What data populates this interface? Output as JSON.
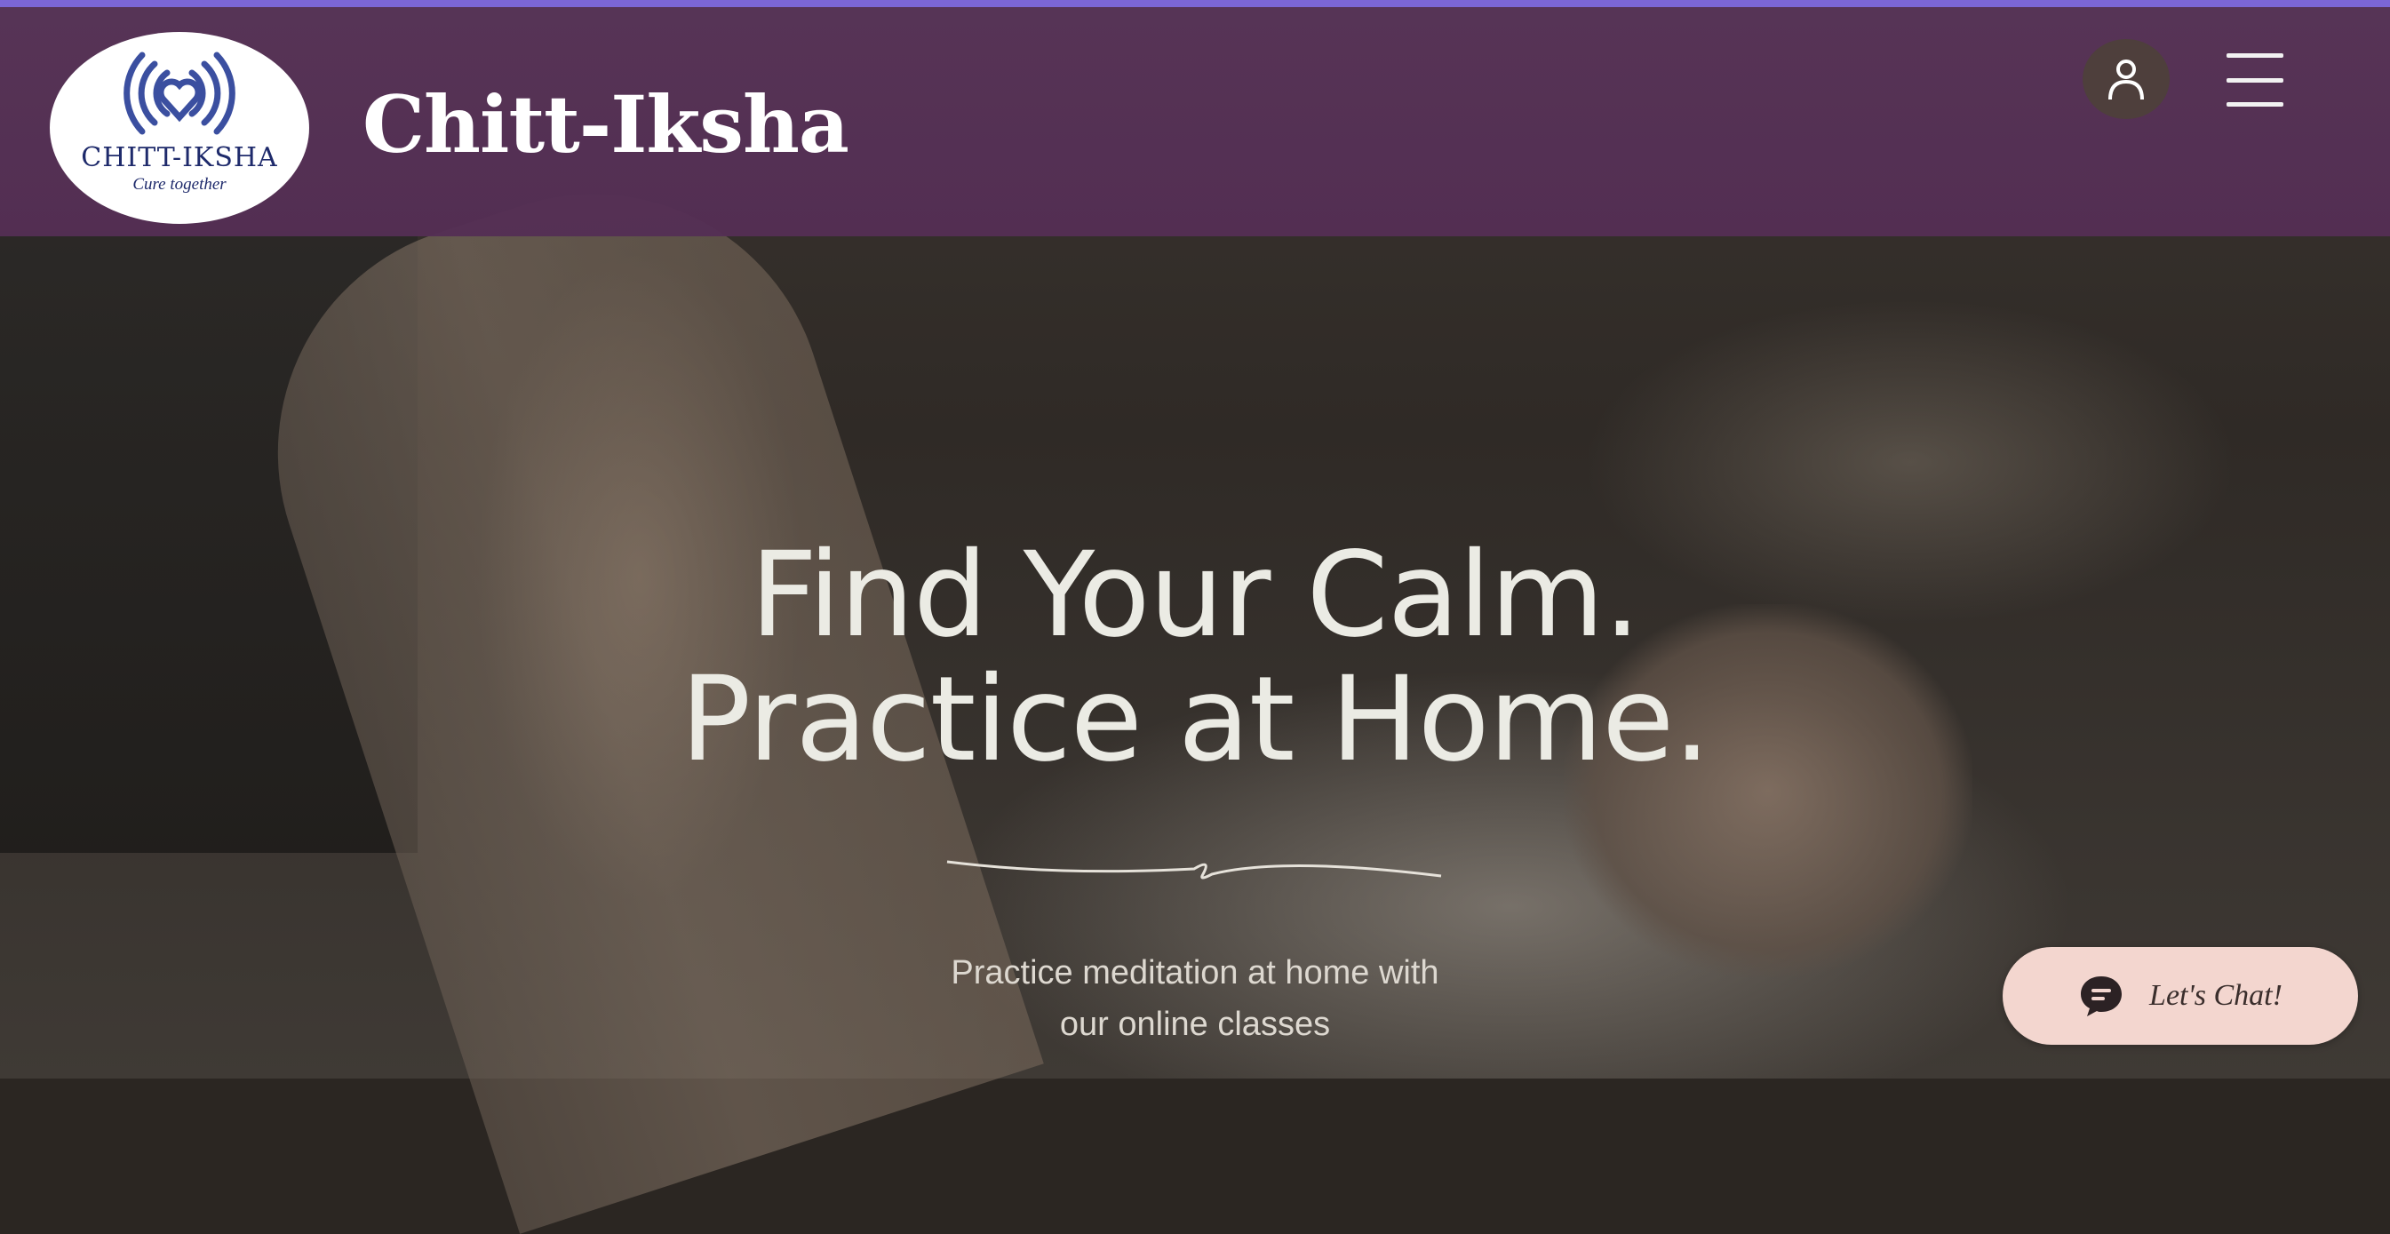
{
  "header": {
    "logo": {
      "title": "CHITT-IKSHA",
      "tagline": "Cure together",
      "icon": "heart-signal-icon"
    },
    "site_title": "Chitt-Iksha",
    "user_icon": "user-icon",
    "menu_icon": "hamburger-menu-icon"
  },
  "hero": {
    "headline_line1": "Find Your Calm.",
    "headline_line2": "Practice at Home.",
    "subtext_line1": "Practice meditation at home with",
    "subtext_line2": "our online classes"
  },
  "chat": {
    "label": "Let's Chat!",
    "icon": "chat-bubble-icon"
  },
  "colors": {
    "header_bg": "#563256",
    "accent_line": "#7b66d6",
    "logo_blue": "#3b4fa0",
    "chat_bg": "#f3d6cf"
  }
}
